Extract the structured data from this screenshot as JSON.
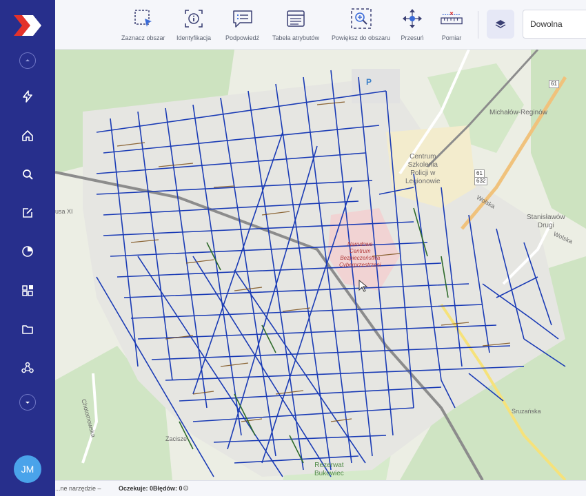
{
  "sidebar": {
    "avatar_initials": "JM",
    "items": [
      {
        "icon": "collapse-up-icon"
      },
      {
        "icon": "lightning-icon"
      },
      {
        "icon": "home-icon"
      },
      {
        "icon": "search-icon"
      },
      {
        "icon": "edit-icon"
      },
      {
        "icon": "pie-chart-icon"
      },
      {
        "icon": "add-widget-icon"
      },
      {
        "icon": "folder-icon"
      },
      {
        "icon": "network-icon"
      },
      {
        "icon": "expand-down-icon"
      }
    ]
  },
  "toolbar": {
    "select_area": "Zaznacz obszar",
    "identify": "Identyfikacja",
    "hint": "Podpowiedź",
    "attribute_table": "Tabela atrybutów",
    "zoom_area": "Powiększ do obszaru",
    "pan": "Przesuń",
    "measure": "Pomiar",
    "basemap_value": "Dowolna"
  },
  "map": {
    "labels": {
      "michalow": "Michałów-Reginów",
      "centrum1": "Centrum",
      "centrum2": "Szkolenia",
      "centrum3": "Policji w",
      "centrum4": "Legionowie",
      "stanislawow1": "Stanisławów",
      "stanislawow2": "Drugi",
      "narodowe1": "Narodowe",
      "narodowe2": "Centrum",
      "narodowe3": "Bezpieczeństwa",
      "narodowe4": "Cyberprzestrzeni",
      "wolska": "Wolska",
      "wolska2": "Wolska",
      "usa": "usa XI",
      "chotomowska": "Chotomowska",
      "zacisze": "Zacisze",
      "rezerwat1": "Rezerwat",
      "rezerwat2": "Bukowiec",
      "sruzanska": "Sruzańska",
      "parking": "P",
      "road61": "61",
      "road61b": "61",
      "road632": "632"
    }
  },
  "statusbar": {
    "tool_prefix": "...ne narzędzie –",
    "pending_label": "Oczekuje:",
    "pending_value": "0",
    "errors_label": "Błędów:",
    "errors_value": "0"
  },
  "colors": {
    "sidebar": "#272f8c",
    "accent": "#e4322b",
    "network": "#1a3bb5",
    "network_brown": "#7a4e18",
    "network_green": "#2e6b2a",
    "forest": "#cfe3c3",
    "urban": "#e8e8e4"
  }
}
